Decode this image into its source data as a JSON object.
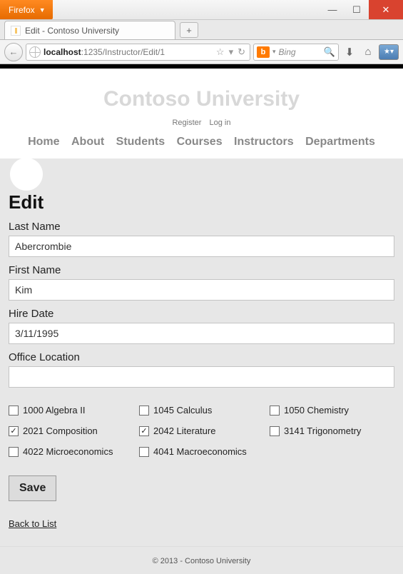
{
  "window": {
    "firefox_label": "Firefox",
    "tab_title": "Edit - Contoso University",
    "new_tab_glyph": "+",
    "minimize_glyph": "—",
    "maximize_glyph": "☐",
    "close_glyph": "✕"
  },
  "navbar": {
    "back_glyph": "←",
    "url_host": "localhost",
    "url_rest": ":1235/Instructor/Edit/1",
    "star_glyph": "☆",
    "dropdown_glyph": "▾",
    "reload_glyph": "↻",
    "search_engine_badge": "b",
    "search_dropdown_glyph": "▾",
    "search_placeholder": "Bing",
    "search_go_glyph": "🔍",
    "download_glyph": "⬇",
    "home_glyph": "⌂",
    "bookmarks_glyph": "★▾"
  },
  "site": {
    "title": "Contoso University",
    "register": "Register",
    "login": "Log in",
    "nav": [
      "Home",
      "About",
      "Students",
      "Courses",
      "Instructors",
      "Departments"
    ]
  },
  "form": {
    "heading": "Edit",
    "labels": {
      "last_name": "Last Name",
      "first_name": "First Name",
      "hire_date": "Hire Date",
      "office_location": "Office Location"
    },
    "values": {
      "last_name": "Abercrombie",
      "first_name": "Kim",
      "hire_date": "3/11/1995",
      "office_location": ""
    },
    "courses": [
      {
        "label": "1000 Algebra II",
        "checked": false
      },
      {
        "label": "1045 Calculus",
        "checked": false
      },
      {
        "label": "1050 Chemistry",
        "checked": false
      },
      {
        "label": "2021 Composition",
        "checked": true
      },
      {
        "label": "2042 Literature",
        "checked": true
      },
      {
        "label": "3141 Trigonometry",
        "checked": false
      },
      {
        "label": "4022 Microeconomics",
        "checked": false
      },
      {
        "label": "4041 Macroeconomics",
        "checked": false
      }
    ],
    "save_label": "Save",
    "back_link": "Back to List"
  },
  "footer": "© 2013 - Contoso University"
}
